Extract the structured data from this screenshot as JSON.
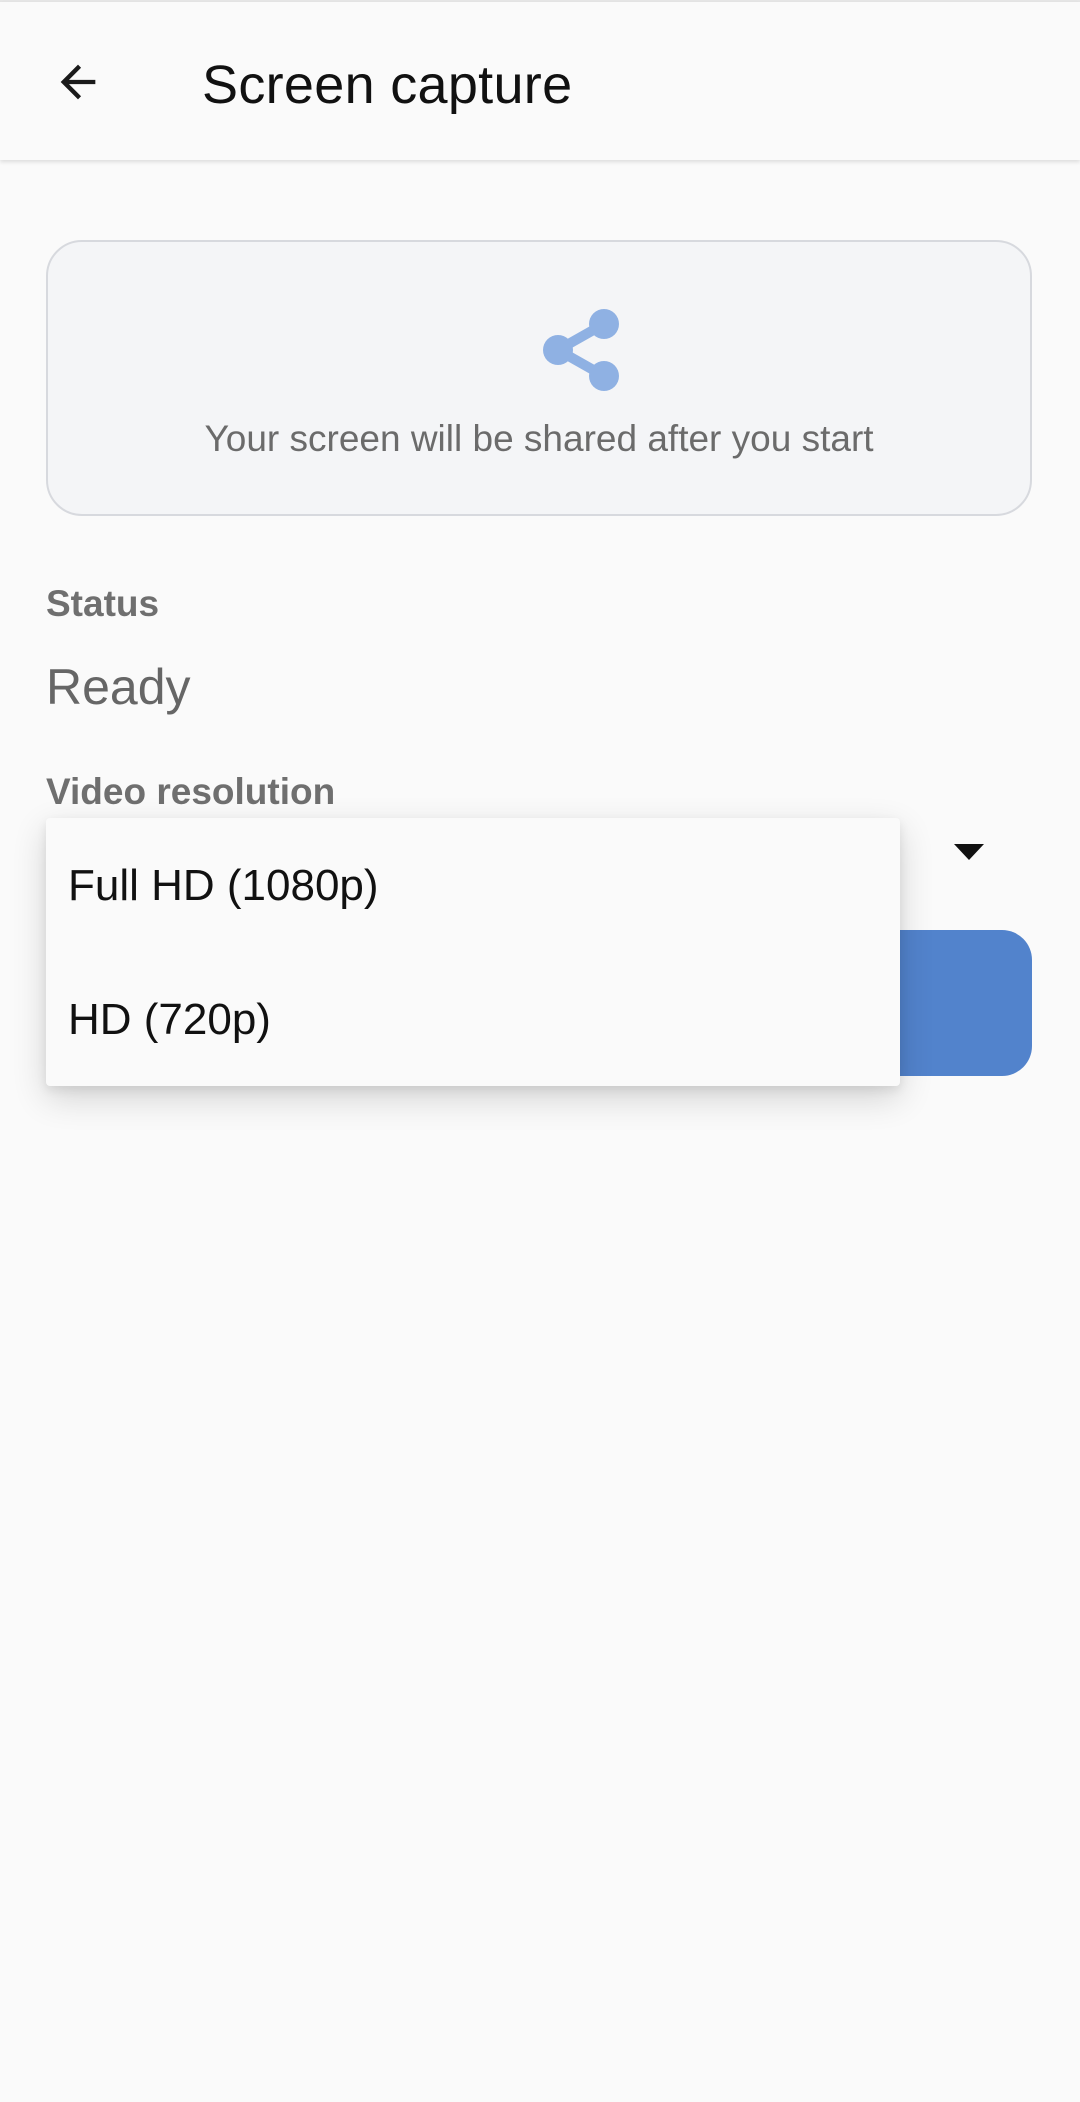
{
  "appbar": {
    "title": "Screen capture",
    "back_icon": "arrow-back-icon"
  },
  "info_card": {
    "icon": "share-icon",
    "icon_color": "#8fb1e3",
    "message": "Your screen will be shared after you start"
  },
  "status": {
    "label": "Status",
    "value": "Ready"
  },
  "video_resolution": {
    "label": "Video resolution",
    "dropdown_icon": "caret-down-icon",
    "options": [
      "Full HD (1080p)",
      "HD (720p)"
    ]
  },
  "colors": {
    "accent": "#5283cc",
    "background": "#fafafa",
    "card_background": "#f4f5f7",
    "card_border": "#d7d9de"
  }
}
